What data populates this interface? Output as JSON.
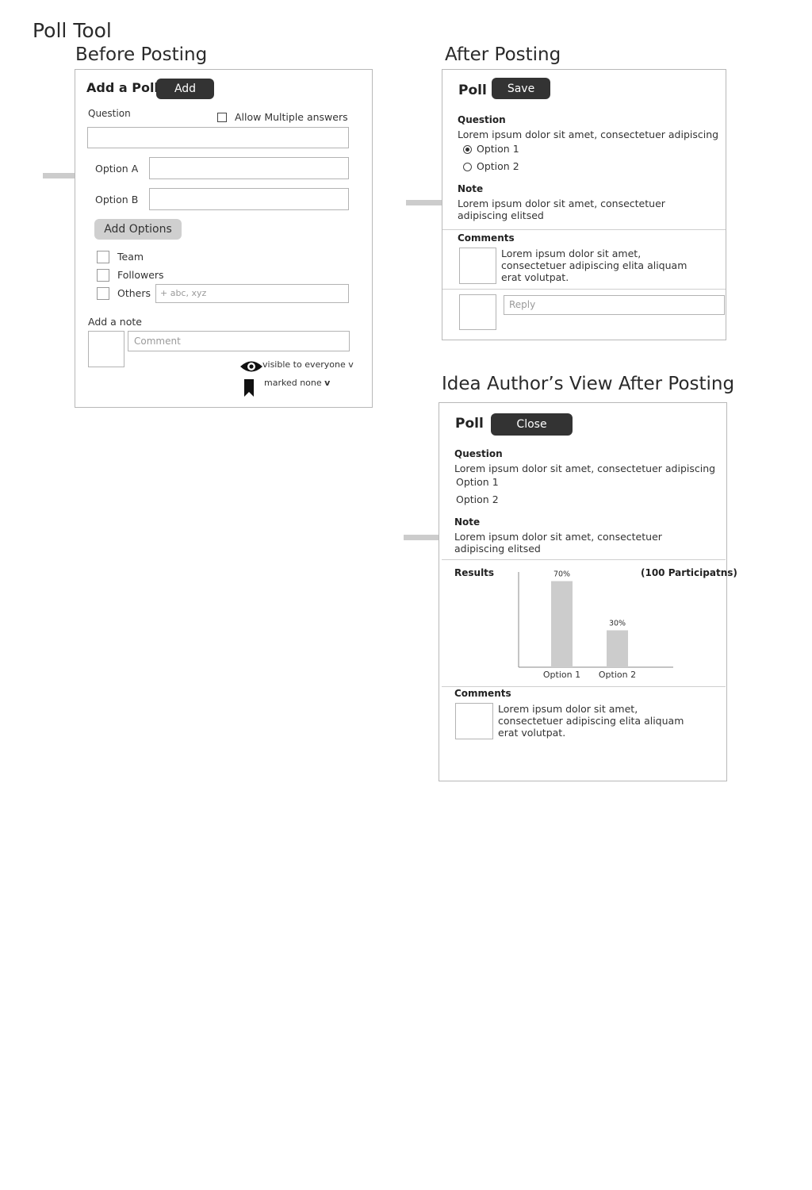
{
  "page_title": "Poll Tool",
  "before": {
    "section_title": "Before Posting",
    "panel_title": "Add a Poll",
    "add_button": "Add",
    "question_label": "Question",
    "allow_multiple_label": "Allow Multiple answers",
    "option_a_label": "Option A",
    "option_b_label": "Option B",
    "add_options_button": "Add  Options",
    "audience": [
      {
        "label": "Team"
      },
      {
        "label": "Followers"
      },
      {
        "label": "Others"
      }
    ],
    "others_placeholder": "+  abc, xyz",
    "note_label": "Add a note",
    "comment_placeholder": "Comment",
    "visibility_text": "visible to everyone v",
    "marked_text": "marked none ",
    "marked_chevron": "v"
  },
  "after": {
    "section_title": "After Posting",
    "panel_title": "Poll",
    "save_button": "Save",
    "question_heading": "Question",
    "question_text": "Lorem ipsum dolor sit amet, consectetuer adipiscing",
    "options": [
      {
        "label": "Option 1",
        "selected": true
      },
      {
        "label": "Option 2",
        "selected": false
      }
    ],
    "note_heading": "Note",
    "note_text": "Lorem ipsum dolor sit amet, consectetuer adipiscing elitsed",
    "comments_heading": "Comments",
    "comment_text": "Lorem ipsum dolor sit amet, consectetuer adipiscing elita aliquam erat volutpat.",
    "reply_placeholder": "Reply"
  },
  "author": {
    "section_title": "Idea Author’s View After Posting",
    "panel_title": "Poll",
    "close_button": "Close",
    "question_heading": "Question",
    "question_text": "Lorem ipsum dolor sit amet, consectetuer adipiscing",
    "options": [
      {
        "label": "Option 1"
      },
      {
        "label": "Option 2"
      }
    ],
    "note_heading": "Note",
    "note_text": "Lorem ipsum dolor sit amet, consectetuer adipiscing elitsed",
    "results_heading": "Results",
    "participants_text": "(100 Participatns)",
    "comments_heading": "Comments",
    "comment_text": "Lorem ipsum dolor sit amet, consectetuer adipiscing elita aliquam erat volutpat."
  },
  "chart_data": {
    "type": "bar",
    "categories": [
      "Option 1",
      "Option 2"
    ],
    "values": [
      70,
      30
    ],
    "data_labels": [
      "70%",
      "30%"
    ],
    "title": "",
    "xlabel": "",
    "ylabel": "",
    "ylim": [
      0,
      100
    ],
    "grid": false,
    "bar_color": "#cccccc"
  }
}
